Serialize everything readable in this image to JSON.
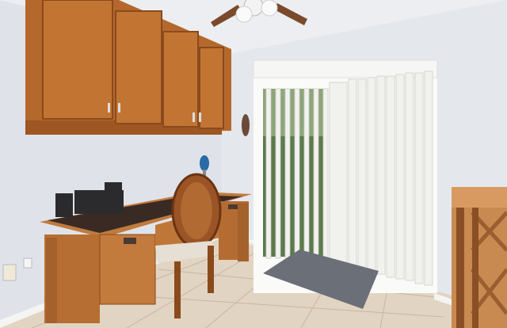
{
  "scene": {
    "description_visible_text": "",
    "colors": {
      "wall": "#e6e9ee",
      "ceiling": "#eef0f3",
      "cabinet": "#b86a2e",
      "cabinet_dark": "#8a4a1c",
      "desk_top": "#3a2a24",
      "floor_tile": "#e3d6c6",
      "grout": "#c9b8a4",
      "blinds": "#f2f2ef",
      "glass_green": "#5f7a4e",
      "rug": "#6b6f78",
      "baseboard": "#f5f5f3"
    }
  }
}
